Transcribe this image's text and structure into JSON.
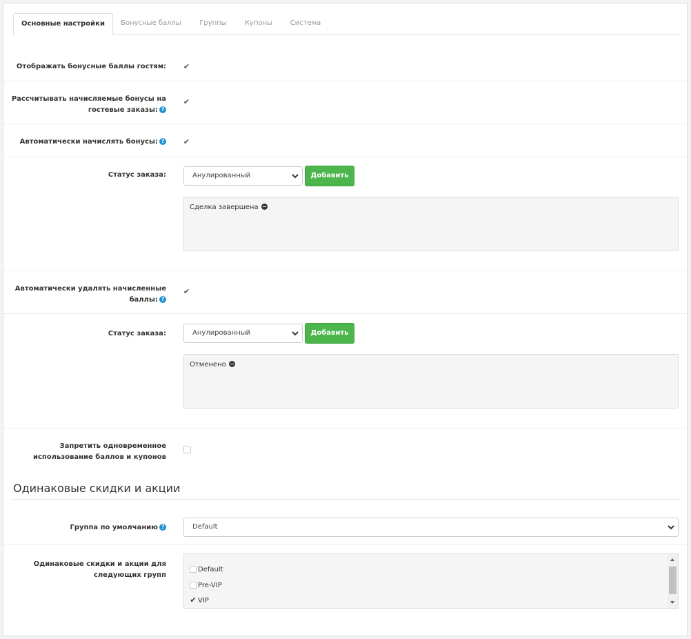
{
  "tabs": [
    {
      "label": "Основные настройки",
      "active": true
    },
    {
      "label": "Бонусные баллы",
      "active": false
    },
    {
      "label": "Группы",
      "active": false
    },
    {
      "label": "Купоны",
      "active": false
    },
    {
      "label": "Система",
      "active": false
    }
  ],
  "fields": {
    "show_guests": {
      "label": "Отображать бонусные баллы гостям:",
      "checked": true
    },
    "guest_orders": {
      "label_line1": "Рассчитывать начисляемые бонусы на",
      "label_line2": "гостевые заказы:",
      "checked": true
    },
    "auto_accrue": {
      "label": "Автоматически начислять бонусы:",
      "checked": true
    },
    "status_accrue": {
      "label": "Статус заказа:",
      "select_value": "Анулированный",
      "add_label": "Добавить",
      "tags": [
        "Сделка завершена"
      ]
    },
    "auto_remove": {
      "label_line1": "Автоматически удалять начисленные",
      "label_line2": "баллы:",
      "checked": true
    },
    "status_remove": {
      "label": "Статус заказа:",
      "select_value": "Анулированный",
      "add_label": "Добавить",
      "tags": [
        "Отменено"
      ]
    },
    "forbid_coupons": {
      "label_line1": "Запретить одновременное",
      "label_line2": "использование баллов и купонов",
      "checked": false
    }
  },
  "section": {
    "title": "Одинаковые скидки и акции"
  },
  "default_group": {
    "label": "Группа по умолчанию",
    "select_value": "Default"
  },
  "same_discounts": {
    "label_line1": "Одинаковые скидки и акции для",
    "label_line2": "следующих групп",
    "items": [
      {
        "label": "Default",
        "checked": false
      },
      {
        "label": "Pre-VIP",
        "checked": false
      },
      {
        "label": "VIP",
        "checked": true
      }
    ]
  },
  "icons": {
    "help": "?",
    "check": "✔"
  },
  "colors": {
    "add_button": "#4cb64c",
    "help_icon": "#1e91cf"
  }
}
